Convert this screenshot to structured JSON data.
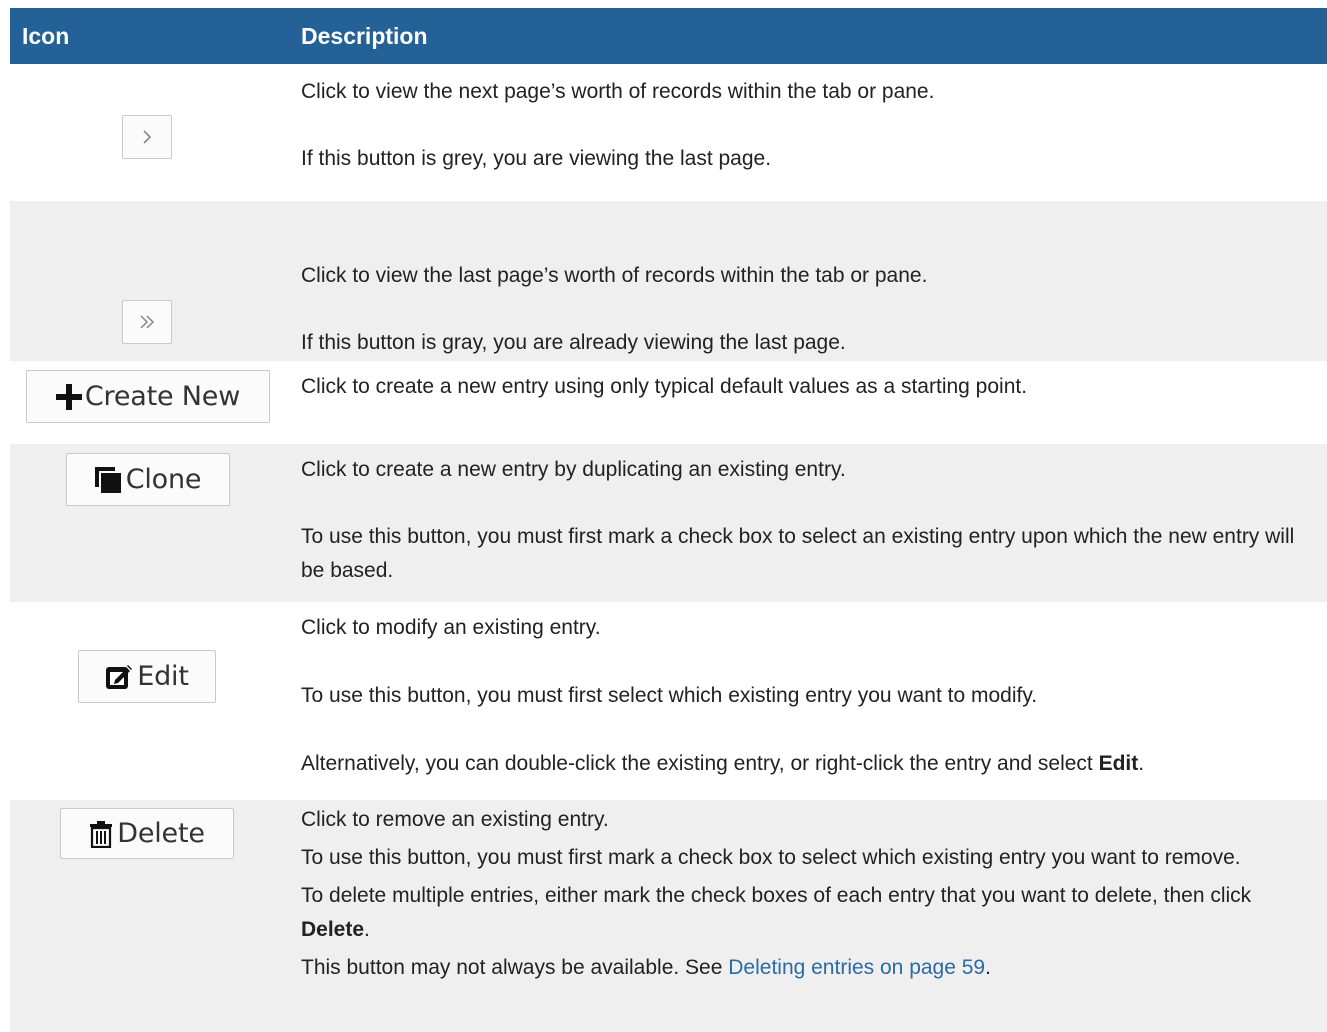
{
  "header": {
    "col_icon": "Icon",
    "col_description": "Description"
  },
  "rows": [
    {
      "button_label": "",
      "icon": "chevron-right-icon",
      "lines": [
        "Click to view the next page’s worth of records within the tab or pane.",
        "If this button is grey, you are viewing the last page."
      ]
    },
    {
      "button_label": "",
      "icon": "double-chevron-right-icon",
      "lines": [
        "Click to view the last page’s worth of records within the tab or pane.",
        "If this button is gray, you are already viewing the last page."
      ]
    },
    {
      "button_label": "Create New",
      "icon": "plus-icon",
      "lines": [
        "Click to create a new entry using only typical default values as a starting point."
      ]
    },
    {
      "button_label": "Clone",
      "icon": "clone-icon",
      "lines": [
        "Click to create a new entry by duplicating an existing entry.",
        "To use this button, you must first mark a check box to select an existing entry upon which the new entry will be based."
      ]
    },
    {
      "button_label": "Edit",
      "icon": "edit-icon",
      "lines": [
        "Click to modify an existing entry.",
        "To use this button, you must first select which existing entry you want to modify."
      ],
      "alt_prefix": "Alternatively, you can double-click the existing entry, or right-click the entry and select ",
      "alt_bold": "Edit",
      "alt_suffix": "."
    },
    {
      "button_label": "Delete",
      "icon": "trash-icon",
      "lines": [
        "Click to remove an existing entry.",
        "To use this button, you must first mark a check box to select which existing entry you want to remove."
      ],
      "multi_prefix": "To delete multiple entries, either mark the check boxes of each entry that you want to delete, then click ",
      "multi_bold": "Delete",
      "multi_suffix": ".",
      "avail_prefix": "This button may not always be available. See ",
      "avail_link": "Deleting entries on page 59",
      "avail_suffix": "."
    }
  ],
  "colors": {
    "header_bg": "#236196",
    "alt_row_bg": "#efefef",
    "link": "#2a6aa6"
  }
}
